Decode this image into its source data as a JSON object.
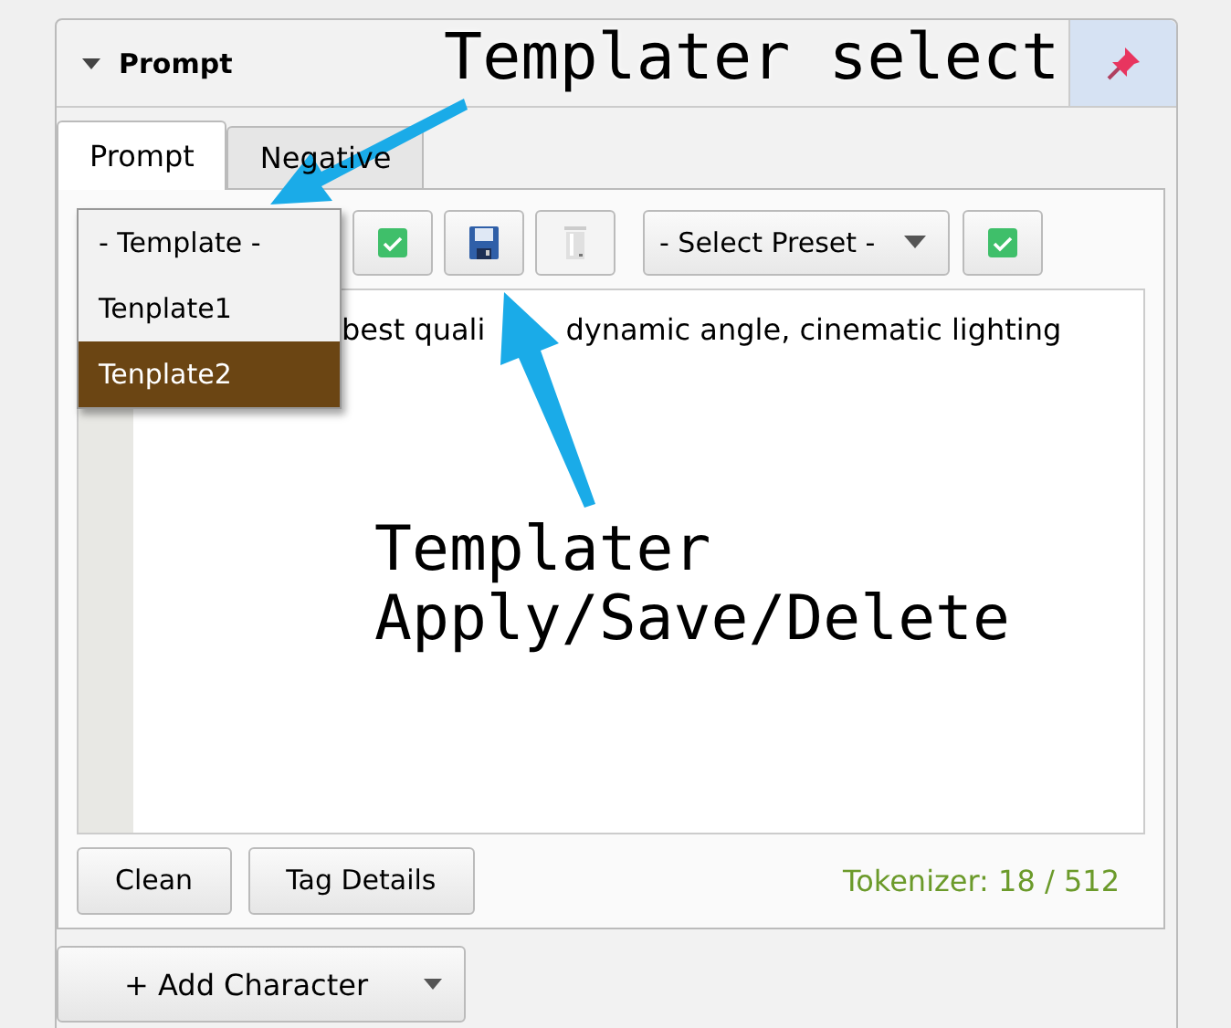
{
  "panel": {
    "title": "Prompt",
    "expanded": true
  },
  "tabs": [
    {
      "label": "Prompt",
      "selected": true
    },
    {
      "label": "Negative",
      "selected": false
    }
  ],
  "template_menu": {
    "options": [
      {
        "label": "- Template -",
        "selected": false
      },
      {
        "label": "Tenplate1",
        "selected": false
      },
      {
        "label": "Tenplate2",
        "selected": true
      }
    ]
  },
  "template_buttons": [
    {
      "kind": "apply",
      "disabled": false
    },
    {
      "kind": "save",
      "disabled": false
    },
    {
      "kind": "delete",
      "disabled": true
    }
  ],
  "preset_select": {
    "value": "- Select Preset -"
  },
  "preset_apply": {
    "kind": "apply",
    "disabled": false
  },
  "prompt_text": [
    "best quali",
    "dynamic angle, cinematic lighting"
  ],
  "buttons": [
    "Clean",
    "Tag Details"
  ],
  "tokenizer": "Tokenizer: 18 / 512",
  "add_character": "+ Add Character",
  "annotations": [
    {
      "lines": [
        "Templater select"
      ]
    },
    {
      "lines": [
        "Templater",
        "Apply/Save/Delete"
      ]
    }
  ]
}
